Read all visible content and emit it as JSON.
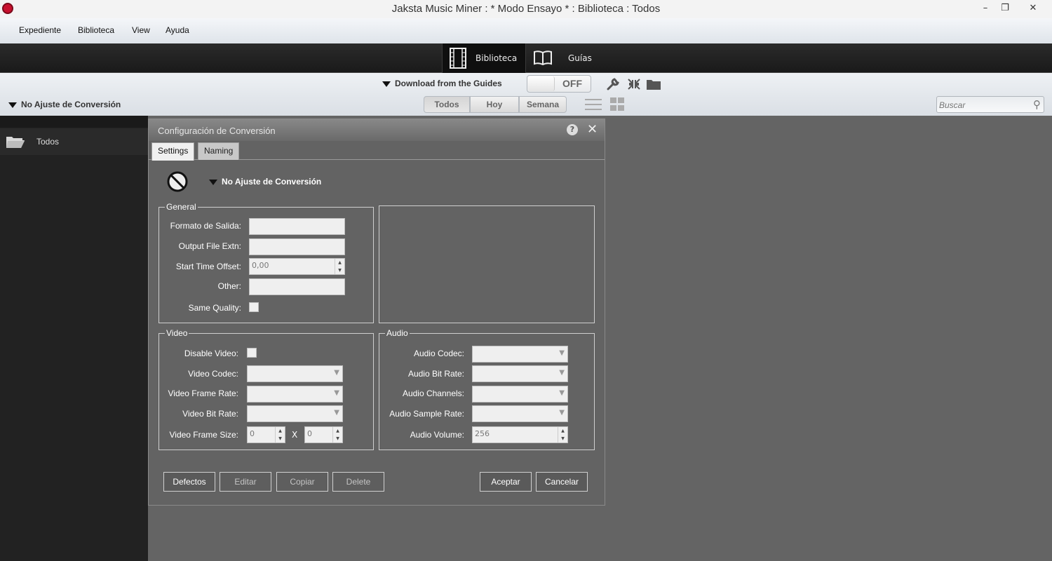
{
  "window": {
    "title": "Jaksta Music Miner : * Modo Ensayo * : Biblioteca : Todos",
    "minimize": "–",
    "restore": "❐",
    "close": "✕"
  },
  "menu": [
    "Expediente",
    "Biblioteca",
    "View",
    "Ayuda"
  ],
  "top_tabs": [
    {
      "label": "Biblioteca",
      "icon": "film-icon",
      "active": true
    },
    {
      "label": "Guías",
      "icon": "book-icon",
      "active": false
    }
  ],
  "toolbar": {
    "download_guides": "Download from the Guides",
    "toggle_state": "OFF",
    "conversion_preset": "No Ajuste de Conversión",
    "filters": [
      "Todos",
      "Hoy",
      "Semana"
    ],
    "active_filter": "Todos",
    "search_placeholder": "Buscar"
  },
  "sidebar": {
    "items": [
      {
        "label": "Todos",
        "icon": "folder-icon"
      }
    ]
  },
  "dialog": {
    "title": "Configuración de Conversión",
    "tabs": [
      "Settings",
      "Naming"
    ],
    "active_tab": "Settings",
    "preset": "No Ajuste de Conversión",
    "general": {
      "legend": "General",
      "output_format_label": "Formato de Salida:",
      "output_format_value": "",
      "output_ext_label": "Output File Extn:",
      "output_ext_value": "",
      "start_offset_label": "Start Time Offset:",
      "start_offset_value": "0,00",
      "other_label": "Other:",
      "other_value": "",
      "same_quality_label": "Same Quality:",
      "same_quality_checked": false
    },
    "video": {
      "legend": "Video",
      "disable_label": "Disable Video:",
      "disable_checked": false,
      "codec_label": "Video Codec:",
      "frame_rate_label": "Video Frame Rate:",
      "bit_rate_label": "Video Bit Rate:",
      "frame_size_label": "Video Frame Size:",
      "frame_width": "0",
      "frame_height": "0",
      "x_label": "X"
    },
    "audio": {
      "legend": "Audio",
      "codec_label": "Audio Codec:",
      "bit_rate_label": "Audio Bit Rate:",
      "channels_label": "Audio Channels:",
      "sample_rate_label": "Audio Sample Rate:",
      "volume_label": "Audio Volume:",
      "volume_value": "256"
    },
    "buttons": {
      "defaults": "Defectos",
      "edit": "Editar",
      "copy": "Copiar",
      "delete": "Delete",
      "accept": "Aceptar",
      "cancel": "Cancelar"
    }
  },
  "colors": {
    "accent_red": "#c8102e",
    "dark_bg": "#222222",
    "dialog_bg": "#636363"
  }
}
